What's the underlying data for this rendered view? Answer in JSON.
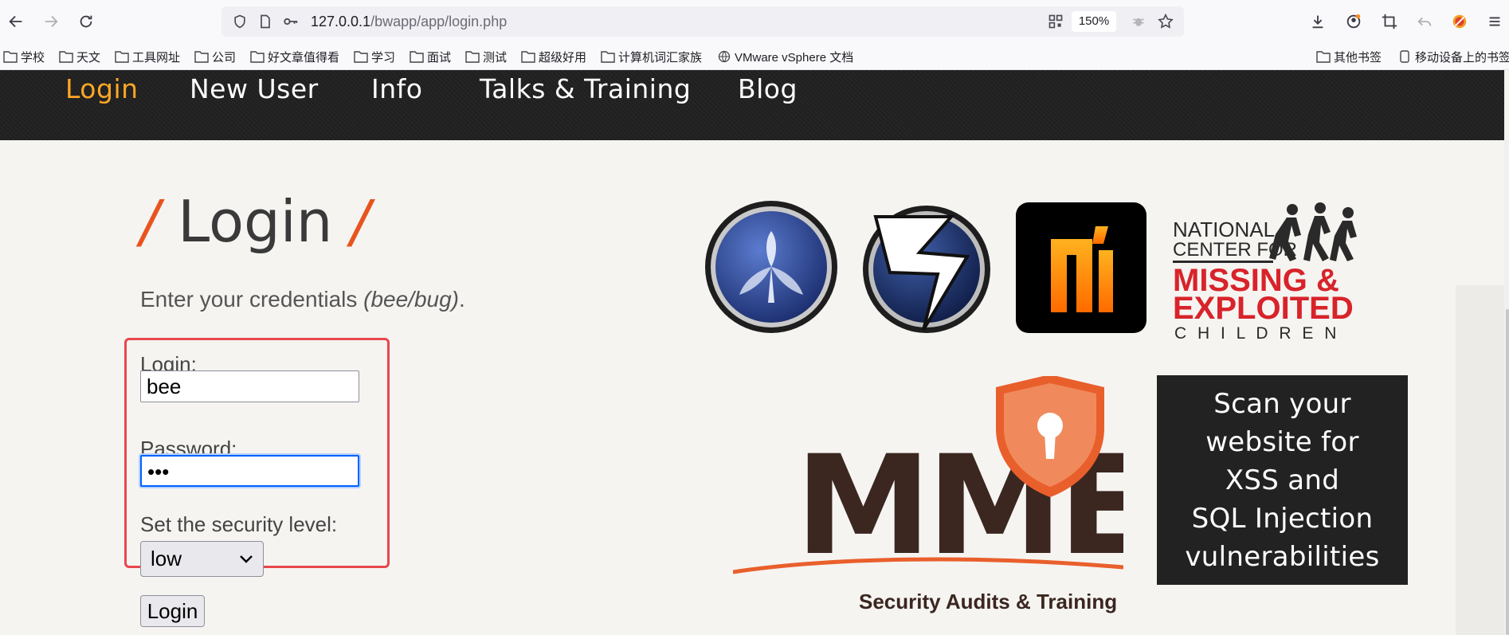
{
  "browser": {
    "url_host": "127.0.0.1",
    "url_path": "/bwapp/app/login.php",
    "zoom": "150%"
  },
  "bookmarks": [
    {
      "label": "学校"
    },
    {
      "label": "天文"
    },
    {
      "label": "工具网址"
    },
    {
      "label": "公司"
    },
    {
      "label": "好文章值得看"
    },
    {
      "label": "学习"
    },
    {
      "label": "面试"
    },
    {
      "label": "测试"
    },
    {
      "label": "超级好用"
    },
    {
      "label": "计算机词汇家族"
    },
    {
      "label": "VMware vSphere 文档"
    }
  ],
  "bookmarks_right": {
    "other": "其他书签",
    "mobile": "移动设备上的书签"
  },
  "site_nav": {
    "items": [
      "Login",
      "New User",
      "Info",
      "Talks & Training",
      "Blog"
    ],
    "active": "Login",
    "active_color": "#ffa726"
  },
  "login_form": {
    "heading_slash": "/",
    "heading": "Login",
    "instruction": "Enter your credentials",
    "instruction_hint": "(bee/bug)",
    "instruction_end": ".",
    "login_label": "Login:",
    "login_value": "bee",
    "password_label": "Password:",
    "password_value": "•••",
    "security_label": "Set the security level:",
    "security_value": "low",
    "submit_label": "Login"
  },
  "logos": {
    "ncmec_line1": "NATIONAL",
    "ncmec_line2": "CENTER FOR",
    "ncmec_line3": "MISSING &",
    "ncmec_line4": "EXPLOITED",
    "ncmec_line5": "C H I L D R E N",
    "mme_word": "MME",
    "mme_tagline": "Security Audits & Training"
  },
  "ad": {
    "lines": [
      "Scan your",
      "website for",
      "XSS and",
      "SQL Injection",
      "vulnerabilities"
    ]
  },
  "colors": {
    "accent_orange": "#e8541f",
    "highlight_red": "#e8474c",
    "focus_blue": "#0062ff"
  }
}
